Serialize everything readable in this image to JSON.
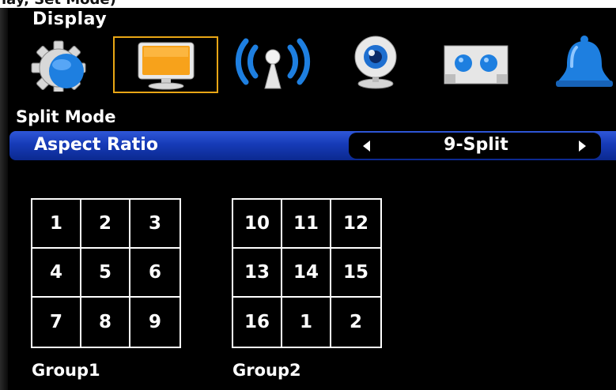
{
  "header_strip": {
    "text": "lay, Set Mode)"
  },
  "menu": {
    "title": "Display",
    "tabs": [
      {
        "icon": "gear-icon",
        "selected": false
      },
      {
        "icon": "monitor-icon",
        "selected": true
      },
      {
        "icon": "wireless-antenna-icon",
        "selected": false
      },
      {
        "icon": "webcam-icon",
        "selected": false
      },
      {
        "icon": "storage-drive-icon",
        "selected": false
      },
      {
        "icon": "bell-icon",
        "selected": false
      }
    ]
  },
  "section": {
    "title": "Split Mode"
  },
  "setting": {
    "label": "Aspect Ratio",
    "value": "9-Split"
  },
  "groups": [
    {
      "label": "Group1",
      "cells": [
        "1",
        "2",
        "3",
        "4",
        "5",
        "6",
        "7",
        "8",
        "9"
      ]
    },
    {
      "label": "Group2",
      "cells": [
        "10",
        "11",
        "12",
        "13",
        "14",
        "15",
        "16",
        "1",
        "2"
      ]
    }
  ],
  "colors": {
    "selection_bar": "#163bb7",
    "tab_highlight": "#e8a615",
    "monitor_screen": "#f7a21b",
    "icon_blue": "#1e7fe0"
  }
}
